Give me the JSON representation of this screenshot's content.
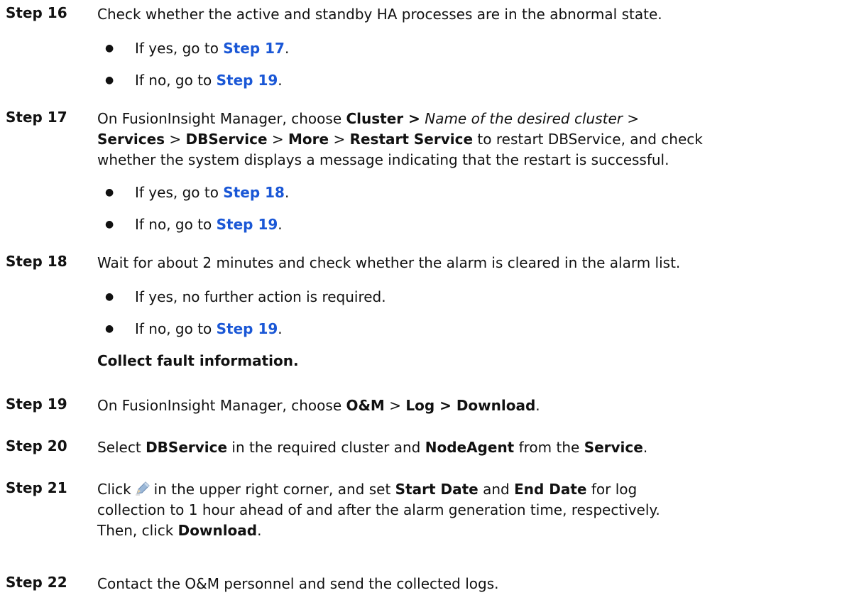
{
  "steps": {
    "s16": {
      "label": "Step 16",
      "text": "Check whether the active and standby HA processes are in the abnormal state.",
      "bullets": [
        {
          "pre": "If yes, go to ",
          "link": "Step 17",
          "post": "."
        },
        {
          "pre": "If no, go to ",
          "link": "Step 19",
          "post": "."
        }
      ]
    },
    "s17": {
      "label": "Step 17",
      "t1": "On FusionInsight Manager, choose ",
      "cluster": "Cluster >",
      "cluster_name": "Name of the desired cluster",
      "gt": ">",
      "services": "Services",
      "dbservice": "DBService",
      "more": "More",
      "restart": "Restart Service",
      "t2": "to restart DBService, and check",
      "line3": "whether the system displays a message indicating that the restart is successful.",
      "bullets": [
        {
          "pre": "If yes, go to ",
          "link": "Step 18",
          "post": "."
        },
        {
          "pre": "If no, go to ",
          "link": "Step 19",
          "post": "."
        }
      ]
    },
    "s18": {
      "label": "Step 18",
      "text": "Wait for about 2 minutes and check whether the alarm is cleared in the alarm list.",
      "bullet1": "If yes, no further action is required.",
      "bullet2": {
        "pre": "If no, go to ",
        "link": "Step 19",
        "post": "."
      }
    },
    "section": "Collect fault information.",
    "s19": {
      "label": "Step 19",
      "t1": "On FusionInsight Manager, choose ",
      "om": "O&M",
      "logdl": "Log > Download",
      "end": "."
    },
    "s20": {
      "label": "Step 20",
      "t1": "Select ",
      "dbservice": "DBService",
      "t2": " in the required cluster and ",
      "nodeagent": "NodeAgent",
      "t3": " from the ",
      "service": "Service",
      "end": "."
    },
    "s21": {
      "label": "Step 21",
      "click": "Click",
      "t1": "in the upper right corner, and set ",
      "start": "Start Date",
      "and": " and ",
      "endd": "End Date",
      "t2": " for log",
      "line2": "collection to 1 hour ahead of and after the alarm generation time, respectively.",
      "t3": "Then, click ",
      "download": "Download",
      "end": "."
    },
    "s22": {
      "label": "Step 22",
      "text": "Contact the O&M personnel and send the collected logs."
    }
  },
  "icons": {
    "edit": "pencil-icon"
  },
  "colors": {
    "link": "#1a57d6",
    "text": "#111111"
  }
}
